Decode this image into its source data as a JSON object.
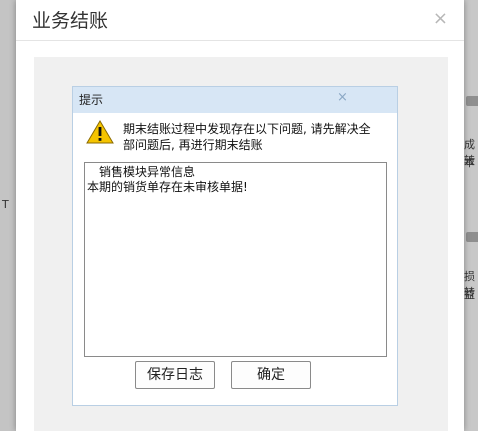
{
  "window": {
    "title": "业务结账",
    "close_glyph": "×"
  },
  "background": {
    "right_labels": [
      "成本",
      "转",
      "损益",
      "转"
    ],
    "left_label": "T"
  },
  "dialog": {
    "title": "提示",
    "close_glyph": "×",
    "message_line1": "期末结账过程中发现存在以下问题, 请先解决全",
    "message_line2": "部问题后, 再进行期末结账",
    "log": {
      "heading": "销售模块异常信息",
      "detail": "本期的销货单存在未审核单据!"
    },
    "buttons": {
      "save_log": "保存日志",
      "ok": "确定"
    }
  },
  "colors": {
    "dialog_titlebar": "#d7e6f5",
    "warning_yellow": "#f5c400"
  }
}
